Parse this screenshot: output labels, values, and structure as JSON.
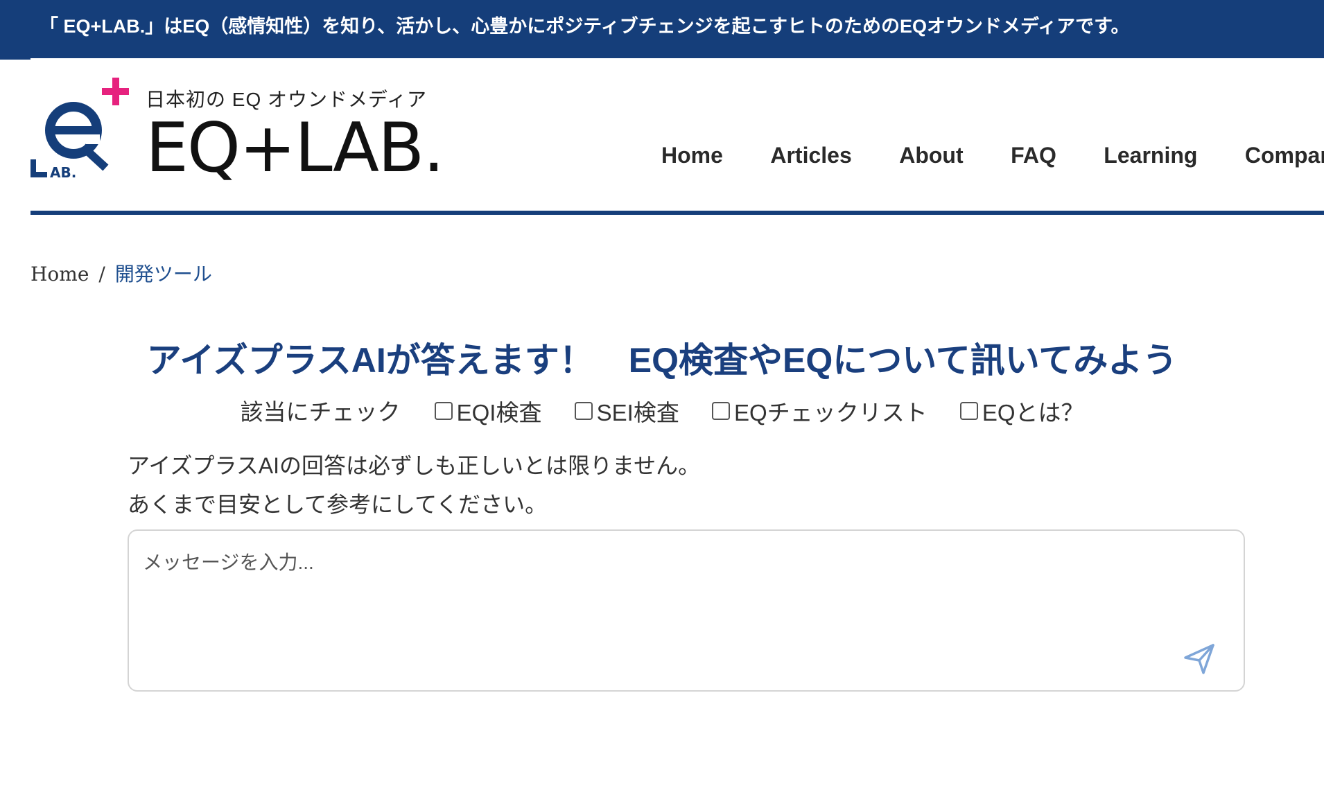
{
  "announcement": {
    "text": "「 EQ+LAB.」はEQ（感情知性）を知り、活かし、心豊かにポジティブチェンジを起こすヒトのためのEQオウンドメディアです。"
  },
  "logo": {
    "tagline": "日本初の EQ オウンドメディア",
    "name": "EQ+LAB.",
    "mark_letters": "AB."
  },
  "nav": {
    "items": [
      {
        "label": "Home"
      },
      {
        "label": "Articles"
      },
      {
        "label": "About"
      },
      {
        "label": "FAQ"
      },
      {
        "label": "Learning"
      },
      {
        "label": "Compar"
      }
    ]
  },
  "breadcrumb": {
    "home": "Home",
    "separator": "/",
    "current": "開発ツール"
  },
  "main": {
    "title": "アイズプラスAIが答えます！　EQ検査やEQについて訊いてみよう",
    "check_lead": "該当にチェック",
    "options": [
      {
        "label": "EQI検査",
        "checked": false
      },
      {
        "label": "SEI検査",
        "checked": false
      },
      {
        "label": "EQチェックリスト",
        "checked": false
      },
      {
        "label": "EQとは？",
        "checked": false
      }
    ],
    "disclaimer_line1": "アイズプラスAIの回答は必ずしも正しいとは限りません。",
    "disclaimer_line2": "あくまで目安として参考にしてください。",
    "message_placeholder": "メッセージを入力...",
    "send_icon": "send-icon"
  },
  "colors": {
    "brand_navy": "#153e7a",
    "brand_pink": "#e6227e",
    "title_blue": "#1a3f7e",
    "send_icon": "#7fa6d8"
  }
}
